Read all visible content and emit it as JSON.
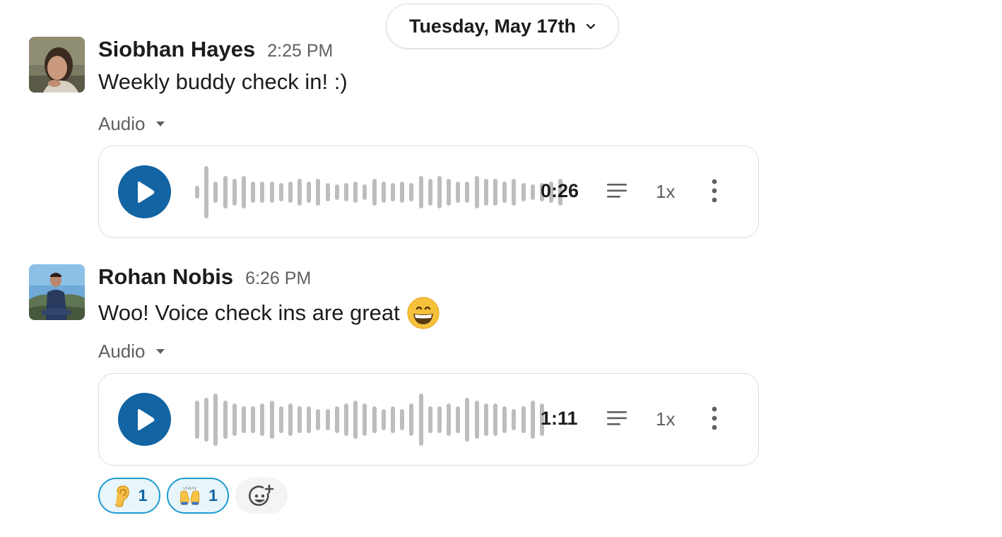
{
  "date_divider": {
    "label": "Tuesday, May 17th"
  },
  "messages": [
    {
      "author": "Siobhan Hayes",
      "time": "2:25 PM",
      "text": "Weekly buddy check in! :)",
      "attachment_label": "Audio",
      "audio": {
        "duration": "0:26",
        "speed": "1x",
        "progress": 0
      }
    },
    {
      "author": "Rohan Nobis",
      "time": "6:26 PM",
      "text": "Woo! Voice check ins are great",
      "emoji": "grinning-face",
      "attachment_label": "Audio",
      "audio": {
        "duration": "1:11",
        "speed": "1x",
        "progress": 0
      },
      "reactions": [
        {
          "emoji": "ear",
          "count": "1"
        },
        {
          "emoji": "raising-hands",
          "count": "1"
        }
      ]
    }
  ],
  "colors": {
    "accent": "#1264a3",
    "reaction_border": "#1d9bd1",
    "reaction_bg": "#e8f5fa",
    "waveform": "#bdbdbd"
  }
}
